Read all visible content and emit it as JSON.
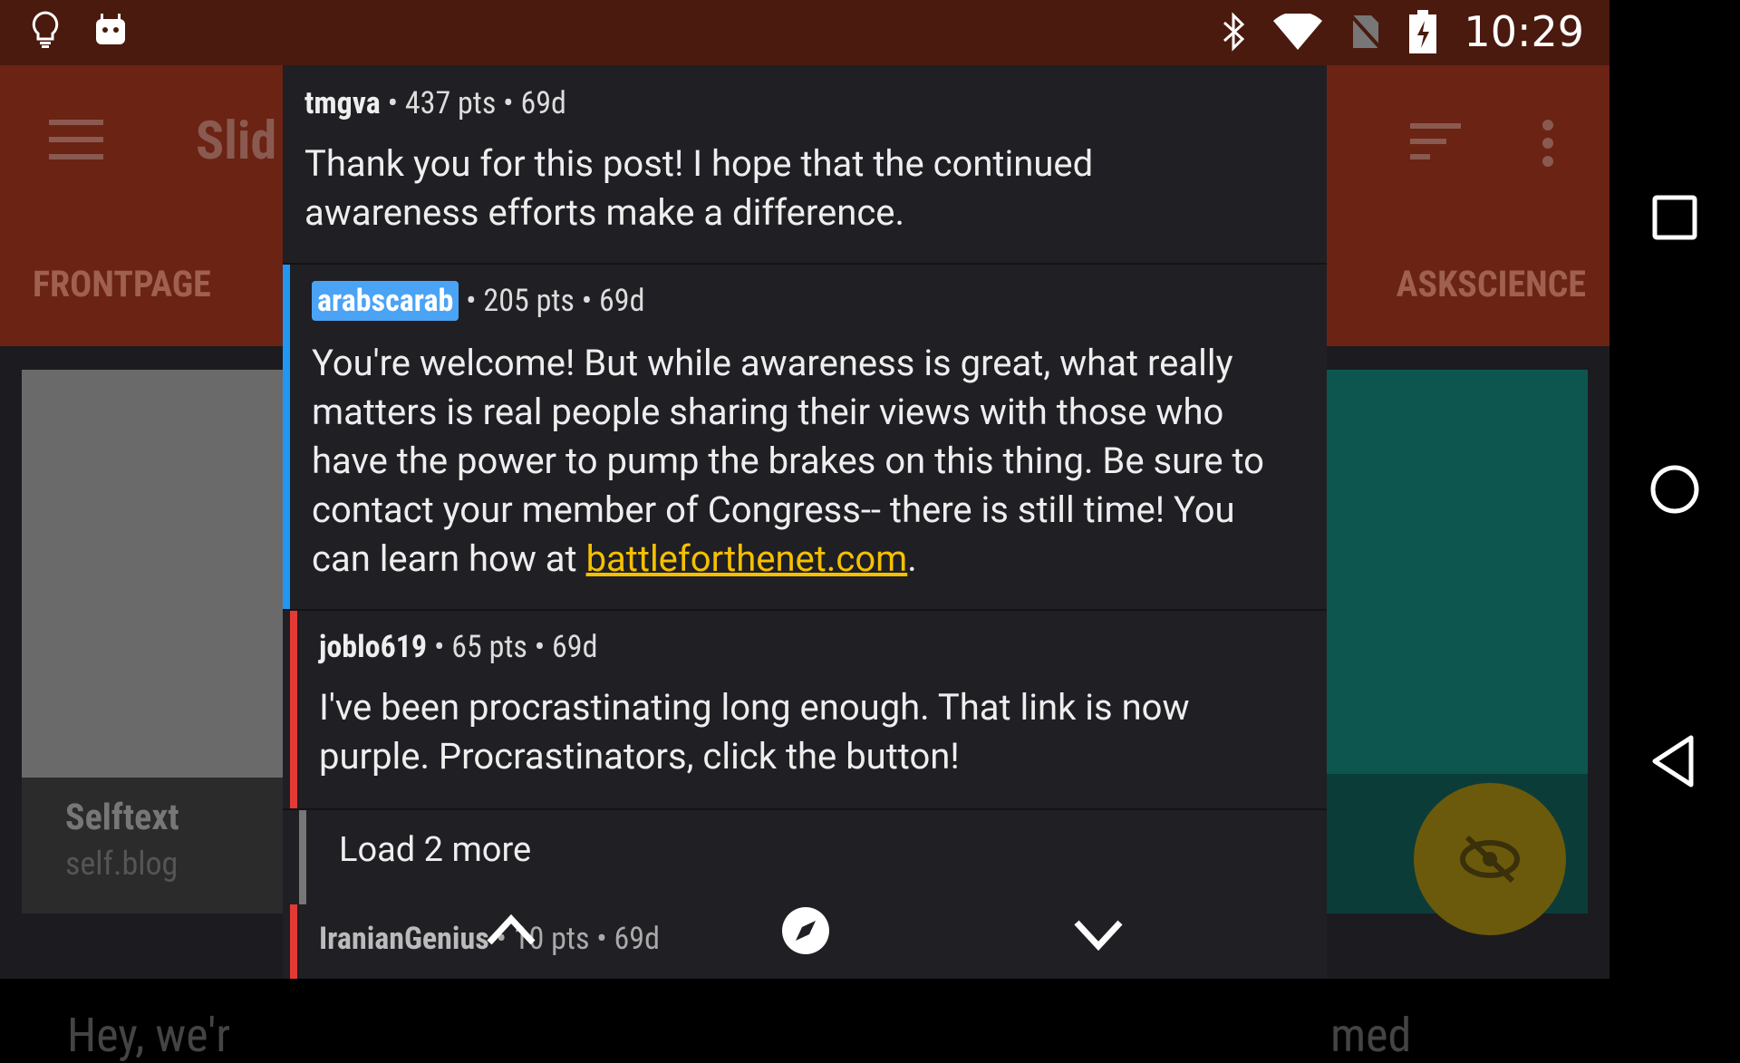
{
  "status_bar": {
    "time": "10:29"
  },
  "background_app": {
    "title": "Slid",
    "tab_left": "FRONTPAGE",
    "tab_right": "ASKSCIENCE",
    "left_card": {
      "title": "Selftext",
      "subtitle": "self.blog"
    },
    "bottom_left_text": "Hey, we'r",
    "bottom_right_text": "med"
  },
  "comments": [
    {
      "author": "tmgva",
      "meta": "• 437 pts • 69d",
      "body": "Thank you for this post! I hope that the continued awareness efforts make a difference."
    },
    {
      "author": "arabscarab",
      "meta": "• 205 pts • 69d",
      "body": "You're welcome! But while awareness is great, what really matters is real people sharing their views with those who have the power to pump the brakes on this thing. Be sure to contact your member of Congress-- there is still time! You can learn how at ",
      "link": "battleforthenet.com",
      "suffix": "."
    },
    {
      "author": "joblo619",
      "meta": "• 65 pts • 69d",
      "body": "I've been procrastinating long enough. That link is now purple. Procrastinators, click the button!"
    },
    {
      "author": "IranianGenius",
      "meta": "• 10 pts • 69d"
    }
  ],
  "load_more": "Load 2 more",
  "colors": {
    "statusbar": "#4a1a0e",
    "toolbar": "#6b2314",
    "dialog": "#1f1f24",
    "op_tag": "#4aa3f5",
    "depth2": "#e53935",
    "depth1": "#2196f3",
    "link": "#f5c000"
  }
}
